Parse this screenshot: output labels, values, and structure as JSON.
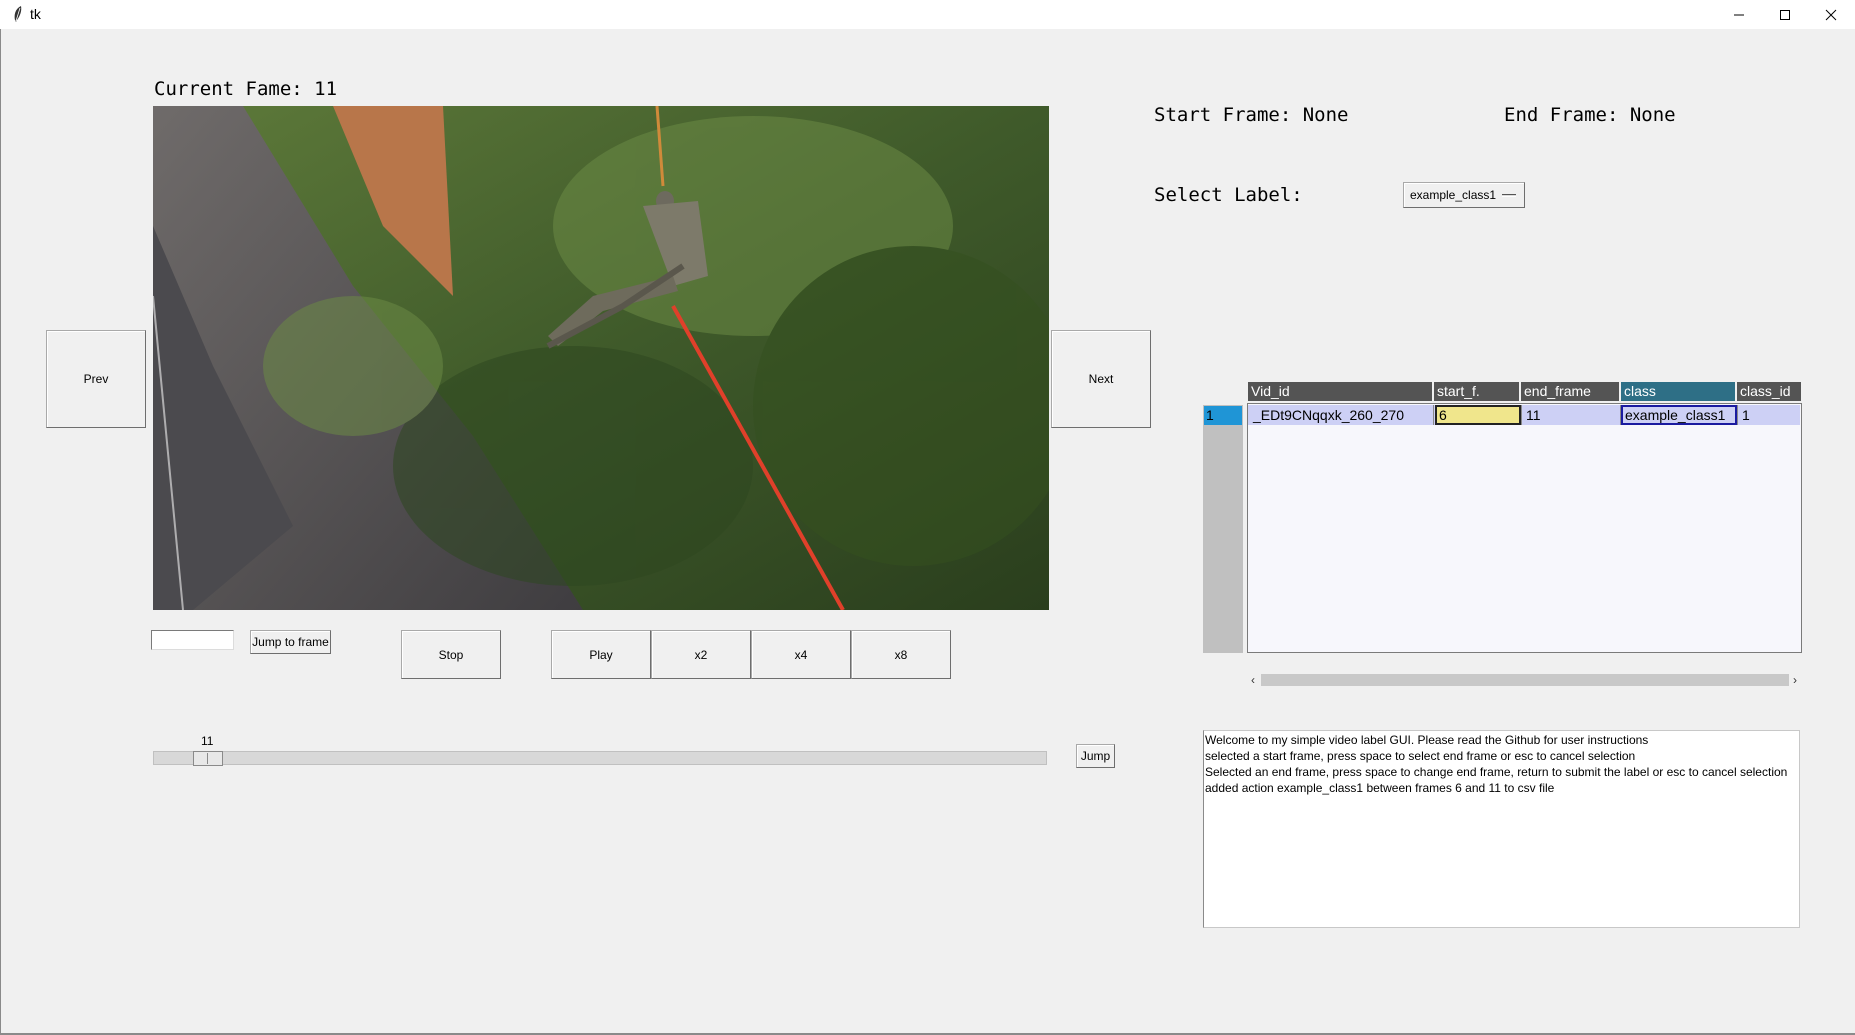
{
  "window": {
    "title": "tk",
    "icon": "feather-icon",
    "controls": [
      "minimize-icon",
      "maximize-icon",
      "close-icon"
    ]
  },
  "video": {
    "current_frame_label": "Current Fame: 11",
    "prev_label": "Prev",
    "next_label": "Next"
  },
  "controls": {
    "frame_entry_value": "",
    "jump_to_frame_label": "Jump to frame",
    "stop_label": "Stop",
    "play_label": "Play",
    "x2_label": "x2",
    "x4_label": "x4",
    "x8_label": "x8",
    "slider_value": "11",
    "slider_fraction": 0.06,
    "jump_label": "Jump"
  },
  "selection": {
    "start_frame": "Start Frame: None",
    "end_frame": "End Frame: None",
    "select_label_text": "Select Label:",
    "selected_label": "example_class1"
  },
  "table": {
    "columns": [
      "Vid_id",
      "start_f.",
      "end_frame",
      "class",
      "class_id"
    ],
    "rows": [
      {
        "index": "1",
        "vid_id": "_EDt9CNqqxk_260_270",
        "start_frame": "6",
        "end_frame": "11",
        "class": "example_class1",
        "class_id": "1"
      }
    ]
  },
  "log": [
    "Welcome to my simple video label GUI. Please read the Github for user instructions",
    "selected a start frame, press space to select end frame or esc to cancel selection",
    "Selected an end frame, press space to change end frame, return to submit the label or esc to cancel selection",
    "added action example_class1 between frames 6 and 11 to csv file"
  ],
  "colors": {
    "window_bg": "#f0f0f0",
    "header_bg": "#545454",
    "header_selected_bg": "#2e6f86",
    "row_selected_bg": "#cdd0f5",
    "edit_cell_bg": "#f0e68c",
    "row_index_bg": "#1f95d6"
  }
}
